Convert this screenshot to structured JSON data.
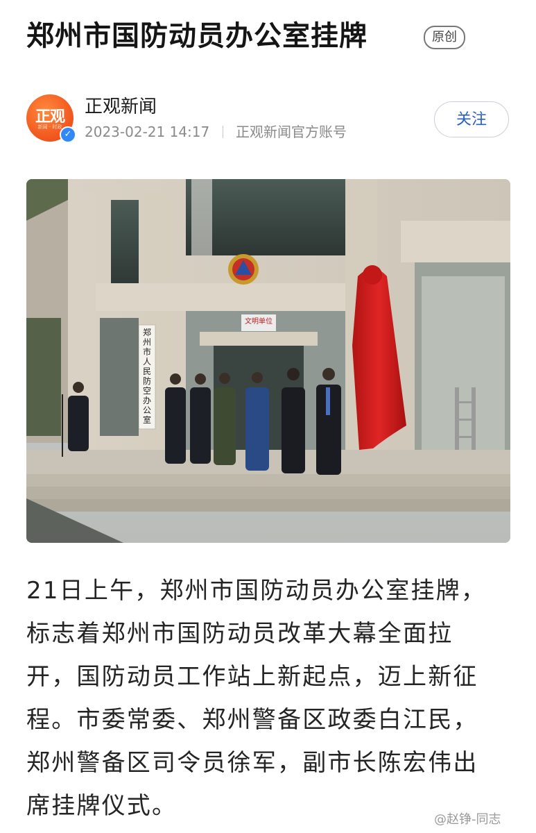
{
  "article": {
    "title": "郑州市国防动员办公室挂牌",
    "original_badge": "原创",
    "author": {
      "avatar_text": "正观",
      "avatar_subtext": "新闻 · 时政",
      "name": "正观新闻",
      "timestamp": "2023-02-21 14:17",
      "account_type": "正观新闻官方账号",
      "follow_label": "关注"
    },
    "photo": {
      "vertical_sign": "郑州市人民防空办公室",
      "door_sign": "文明单位"
    },
    "body_lines": [
      "21日上午，郑州市国防动员办公室挂牌，",
      "标志着郑州市国防动员改革大幕全面拉",
      "开，国防动员工作站上新起点，迈上新征",
      "程。市委常委、郑州警备区政委白江民，",
      "郑州警备区司令员徐军，副市长陈宏伟出",
      "席挂牌仪式。"
    ],
    "watermark": "@赵铮-同志"
  },
  "colors": {
    "avatar_orange": "#f1571f",
    "verify_blue": "#2f8af5",
    "follow_text_blue": "#2a5ec9",
    "drape_red": "#d81e1e"
  }
}
